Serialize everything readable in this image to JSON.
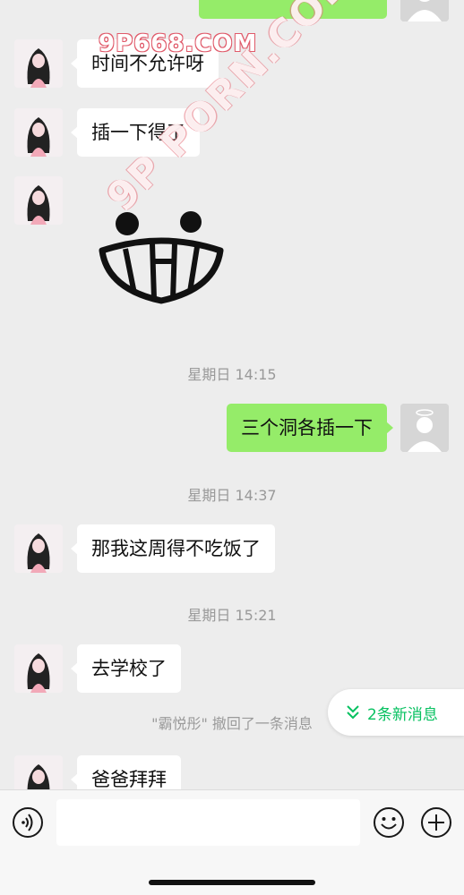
{
  "watermark": {
    "top": "9P668.COM",
    "diagonal": "9P PORN.COM"
  },
  "messages": {
    "m1": "时间不允许呀",
    "m2": "插一下得了",
    "m3": "三个洞各插一下",
    "m4": "那我这周得不吃饭了",
    "m5": "去学校了",
    "m6": "爸爸拜拜"
  },
  "times": {
    "t1": "星期日 14:15",
    "t2": "星期日 14:37",
    "t3": "星期日 15:21"
  },
  "recall_notice": "\"霸悦彤\" 撤回了一条消息",
  "new_messages_pill": "2条新消息",
  "colors": {
    "accent": "#07c160",
    "sent_bubble": "#95ec69",
    "received_bubble": "#ffffff",
    "background": "#ededed"
  },
  "icons": {
    "voice": "voice-icon",
    "emoji": "emoji-icon",
    "more": "plus-icon",
    "scroll_down": "double-chevron-down-icon"
  }
}
